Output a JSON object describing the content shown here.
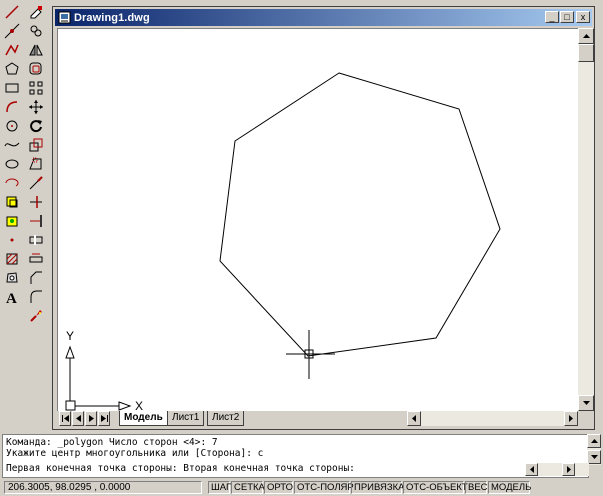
{
  "window": {
    "title": "Drawing1.dwg",
    "controls": {
      "minimize": "_",
      "restore": "□",
      "close": "x"
    }
  },
  "toolbars": {
    "draw": [
      "line-icon",
      "construction-line-icon",
      "polyline-icon",
      "polygon-icon",
      "rectangle-icon",
      "arc-icon",
      "circle-icon",
      "spline-icon",
      "ellipse-icon",
      "ellipse-arc-icon",
      "insert-block-icon",
      "make-block-icon",
      "point-icon",
      "hatch-icon",
      "region-icon",
      "multiline-text-icon"
    ],
    "modify": [
      "erase-icon",
      "copy-icon",
      "mirror-icon",
      "offset-icon",
      "array-icon",
      "move-icon",
      "rotate-icon",
      "scale-icon",
      "stretch-icon",
      "lengthen-icon",
      "trim-icon",
      "extend-icon",
      "break-icon",
      "break-at-point-icon",
      "chamfer-icon",
      "fillet-icon",
      "explode-icon"
    ]
  },
  "ucs": {
    "x_label": "X",
    "y_label": "Y"
  },
  "tabs": [
    "Модель",
    "Лист1",
    "Лист2"
  ],
  "command_lines": [
    "Команда: _polygon Число сторон <4>: 7",
    "Укажите центр многоугольника или [Сторона]: с",
    "Первая конечная точка стороны: Вторая конечная точка стороны:"
  ],
  "status": {
    "coords": "206.3005, 98.0295 , 0.0000",
    "buttons": [
      "ШАГ",
      "СЕТКА",
      "ОРТО",
      "ОТС-ПОЛЯР",
      "ПРИВЯЗКА",
      "ОТС-ОБЪЕКТ",
      "ВЕС",
      "МОДЕЛЬ"
    ]
  }
}
